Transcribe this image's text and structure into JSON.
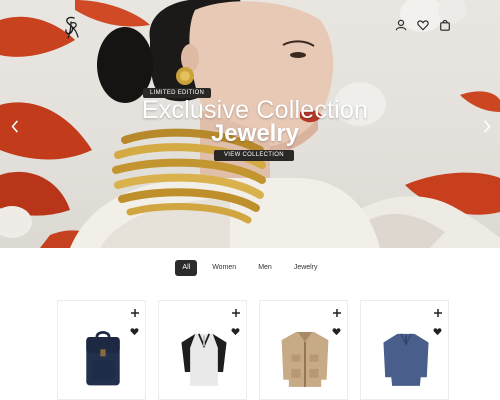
{
  "header": {
    "logo_icon": "monogram-logo-icon",
    "icons": [
      "account-icon",
      "wishlist-heart-icon",
      "shopping-bag-icon"
    ]
  },
  "hero": {
    "badge": "LIMITED EDITION",
    "title": "Exclusive Collection",
    "subtitle": "Jewelry",
    "cta": "VIEW COLLECTION",
    "prev_icon": "chevron-left-icon",
    "next_icon": "chevron-right-icon",
    "colors": {
      "petal": "#c9421f",
      "gold": "#c9a23a",
      "backdrop": "#e7e4df"
    }
  },
  "filters": {
    "tabs": [
      "All",
      "Women",
      "Men",
      "Jewelry"
    ],
    "active": "All"
  },
  "products": [
    {
      "image": "navy-backpack",
      "add_icon": "plus-icon",
      "fav_icon": "heart-icon"
    },
    {
      "image": "white-henley-black-sleeves",
      "add_icon": "plus-icon",
      "fav_icon": "heart-icon"
    },
    {
      "image": "beige-field-jacket",
      "add_icon": "plus-icon",
      "fav_icon": "heart-icon"
    },
    {
      "image": "blue-henley-sweater",
      "add_icon": "plus-icon",
      "fav_icon": "heart-icon"
    }
  ]
}
